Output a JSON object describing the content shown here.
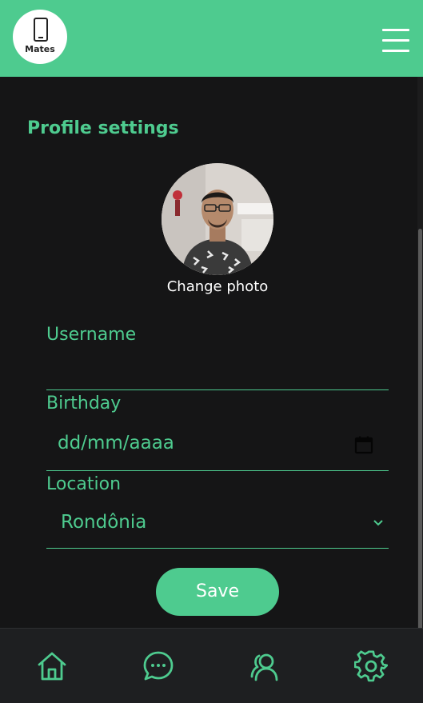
{
  "header": {
    "logo_text": "Mates",
    "menu_icon": "hamburger-menu-icon"
  },
  "main": {
    "title": "Profile settings",
    "change_photo_label": "Change photo",
    "fields": {
      "username": {
        "label": "Username",
        "value": ""
      },
      "birthday": {
        "label": "Birthday",
        "placeholder": "dd/mm/aaaa",
        "icon": "calendar-icon"
      },
      "location": {
        "label": "Location",
        "value": "Rondônia",
        "icon": "chevron-down-icon"
      }
    },
    "save_label": "Save"
  },
  "bottom_nav": {
    "items": [
      {
        "icon": "home-icon"
      },
      {
        "icon": "chat-icon"
      },
      {
        "icon": "friends-icon"
      },
      {
        "icon": "settings-icon"
      }
    ]
  },
  "colors": {
    "accent": "#4ecb8f",
    "background": "#151516",
    "nav_background": "#1e1f21"
  }
}
